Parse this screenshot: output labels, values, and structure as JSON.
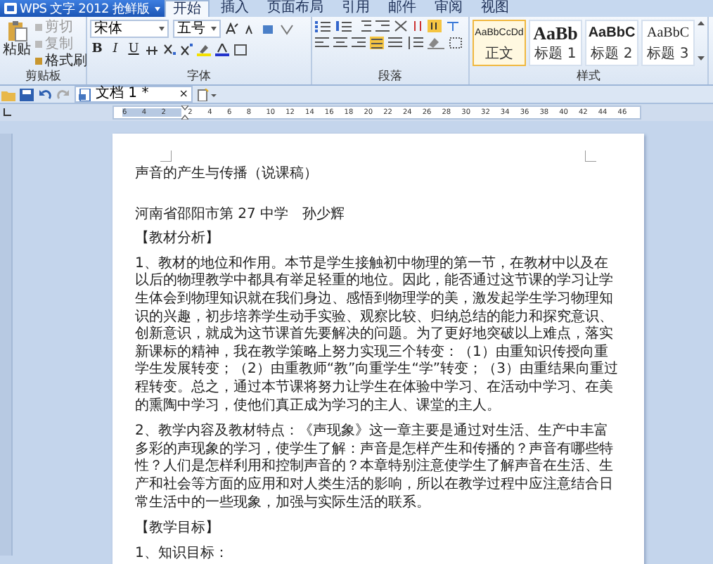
{
  "app_button": {
    "label": "WPS 文字 2012 抢鲜版"
  },
  "tabs": [
    {
      "label": "开始",
      "selected": true
    },
    {
      "label": "插入",
      "selected": false
    },
    {
      "label": "页面布局",
      "selected": false
    },
    {
      "label": "引用",
      "selected": false
    },
    {
      "label": "邮件",
      "selected": false
    },
    {
      "label": "审阅",
      "selected": false
    },
    {
      "label": "视图",
      "selected": false
    }
  ],
  "clipboard": {
    "paste": "粘贴",
    "cut": "剪切",
    "copy": "复制",
    "format_painter": "格式刷",
    "group": "剪贴板"
  },
  "font": {
    "name": "宋体",
    "size": "五号",
    "group": "字体",
    "bold": "B",
    "italic": "I",
    "underline": "U"
  },
  "paragraph": {
    "group": "段落"
  },
  "styles": {
    "group": "样式",
    "items": [
      {
        "sample": "AaBbCcDd",
        "label": "正文",
        "kind": "normal",
        "selected": true
      },
      {
        "sample": "AaBb",
        "label": "标题 1",
        "kind": "h1",
        "selected": false
      },
      {
        "sample": "AaBbC",
        "label": "标题 2",
        "kind": "h2",
        "selected": false
      },
      {
        "sample": "AaBbC",
        "label": "标题 3",
        "kind": "h3",
        "selected": false
      }
    ]
  },
  "document_tab": {
    "title": "文档 1 *",
    "close": "×"
  },
  "ruler": {
    "ticks": [
      "6",
      "4",
      "2",
      "2",
      "4",
      "6",
      "8",
      "10",
      "12",
      "14",
      "16",
      "18",
      "20",
      "22",
      "24",
      "26",
      "28",
      "30",
      "32",
      "34",
      "36",
      "38",
      "40",
      "42",
      "44",
      "46"
    ]
  },
  "document": {
    "paragraphs": [
      {
        "kind": "title",
        "text": "声音的产生与传播（说课稿）"
      },
      {
        "kind": "author",
        "text": "河南省邵阳市第 27 中学　孙少辉"
      },
      {
        "kind": "heading",
        "text": "【教材分析】"
      },
      {
        "kind": "body",
        "text": "1、教材的地位和作用。本节是学生接触初中物理的第一节，在教材中以及在以后的物理教学中都具有举足轻重的地位。因此，能否通过这节课的学习让学生体会到物理知识就在我们身边、感悟到物理学的美，激发起学生学习物理知识的兴趣，初步培养学生动手实验、观察比较、归纳总结的能力和探究意识、创新意识，就成为这节课首先要解决的问题。为了更好地突破以上难点，落实新课标的精神，我在教学策略上努力实现三个转变：（1）由重知识传授向重学生发展转变；（2）由重教师“教”向重学生“学”转变；（3）由重结果向重过程转变。总之，通过本节课将努力让学生在体验中学习、在活动中学习、在美的熏陶中学习，使他们真正成为学习的主人、课堂的主人。"
      },
      {
        "kind": "body",
        "text": "2、教学内容及教材特点：《声现象》这一章主要是通过对生活、生产中丰富多彩的声现象的学习，使学生了解：声音是怎样产生和传播的？声音有哪些特性？人们是怎样利用和控制声音的？本章特别注意使学生了解声音在生活、生产和社会等方面的应用和对人类生活的影响，所以在教学过程中应注意结合日常生活中的一些现象，加强与实际生活的联系。"
      },
      {
        "kind": "heading",
        "text": "【教学目标】"
      },
      {
        "kind": "body",
        "text": "1、知识目标："
      }
    ]
  }
}
